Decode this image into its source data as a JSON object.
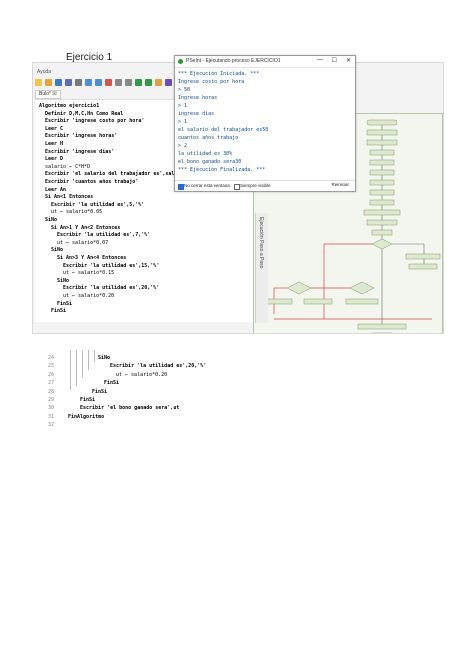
{
  "document": {
    "title": "Ejercicio 1"
  },
  "ide": {
    "menu_help": "Ayuda",
    "tab_label": "Bulo* ☒",
    "side_tab": "Ejecución Paso a Paso",
    "toolbar_icons": [
      "new-icon",
      "open-icon",
      "save-icon",
      "save-as-icon",
      "print-icon",
      "undo-icon",
      "redo-icon",
      "cut-icon",
      "copy-icon",
      "paste-icon",
      "run-icon",
      "step-icon",
      "flowchart-icon",
      "help-icon"
    ],
    "code": [
      {
        "t": "Algoritmo ejercicio1",
        "k": true,
        "i": 0
      },
      {
        "t": "Definir D,M,C,Hn Como Real",
        "k": true,
        "i": 1
      },
      {
        "t": "Escribir 'ingrese costo por hora'",
        "k": true,
        "i": 1
      },
      {
        "t": "Leer C",
        "k": true,
        "i": 1
      },
      {
        "t": "Escribir 'ingrese horas'",
        "k": true,
        "i": 1
      },
      {
        "t": "Leer H",
        "k": true,
        "i": 1
      },
      {
        "t": "Escribir 'ingrese dias'",
        "k": true,
        "i": 1
      },
      {
        "t": "Leer D",
        "k": true,
        "i": 1
      },
      {
        "t": "salario ← C*H*D",
        "k": false,
        "i": 1
      },
      {
        "t": "Escribir 'el salario del trabajador es',salario",
        "k": true,
        "i": 1
      },
      {
        "t": "Escribir 'cuantos años trabajo'",
        "k": true,
        "i": 1
      },
      {
        "t": "Leer An",
        "k": true,
        "i": 1
      },
      {
        "t": "Si An<1 Entonces",
        "k": true,
        "i": 1
      },
      {
        "t": "Escribir 'la utilidad es',5,'%'",
        "k": true,
        "i": 2
      },
      {
        "t": "ut ← salario*0.05",
        "k": false,
        "i": 2
      },
      {
        "t": "SiNo",
        "k": true,
        "i": 1
      },
      {
        "t": "Si An>1 Y An<2 Entonces",
        "k": true,
        "i": 2
      },
      {
        "t": "Escribir 'la utilidad es',7,'%'",
        "k": true,
        "i": 3
      },
      {
        "t": "ut ← salario*0.07",
        "k": false,
        "i": 3
      },
      {
        "t": "SiNo",
        "k": true,
        "i": 2
      },
      {
        "t": "Si An>3 Y An<4 Entonces",
        "k": true,
        "i": 3
      },
      {
        "t": "Escribir 'la utilidad es',15,'%'",
        "k": true,
        "i": 4
      },
      {
        "t": "ut ← salario*0.15",
        "k": false,
        "i": 4
      },
      {
        "t": "SiNo",
        "k": true,
        "i": 3
      },
      {
        "t": "Escribir 'la utilidad es',20,'%'",
        "k": true,
        "i": 4
      },
      {
        "t": "ut ← salario*0.20",
        "k": false,
        "i": 4
      },
      {
        "t": "FinSi",
        "k": true,
        "i": 3
      },
      {
        "t": "FinSi",
        "k": true,
        "i": 2
      }
    ]
  },
  "console": {
    "title": "PSeInt - Ejecutando proceso EJERCICIO1",
    "minimize": "—",
    "maximize": "☐",
    "close": "✕",
    "lines": [
      "*** Ejecución Iniciada. ***",
      "Ingrese costo por hora",
      "> 50",
      "Ingrese horas",
      "> 1",
      "ingrese dias",
      "> 1",
      "el salario del trabajador es50",
      "cuantos años trabajo",
      "> 2",
      "la utilidad es 30%",
      "el bono ganado sera30",
      "*** Ejecución Finalizada. ***"
    ],
    "checkbox_no_close": "No cerrar esta ventana",
    "checkbox_no_close_checked": true,
    "checkbox_always_visible": "Siempre visible",
    "checkbox_always_visible_checked": false,
    "restart_button": "Reiniciar"
  },
  "snippet": {
    "lines": [
      {
        "n": "24",
        "t": "SiNo",
        "k": true
      },
      {
        "n": "25",
        "t": "Escribir 'la utilidad es',20,'%'",
        "k": true
      },
      {
        "n": "26",
        "t": "ut ← salario*0.20",
        "k": false
      },
      {
        "n": "27",
        "t": "FinSi",
        "k": true
      },
      {
        "n": "28",
        "t": "FinSi",
        "k": true
      },
      {
        "n": "29",
        "t": "FinSi",
        "k": true
      },
      {
        "n": "30",
        "t": "Escribir 'el bono ganado sera',ut",
        "k": true
      },
      {
        "n": "31",
        "t": "FinAlgoritmo",
        "k": true
      },
      {
        "n": "32",
        "t": "",
        "k": false
      }
    ]
  }
}
